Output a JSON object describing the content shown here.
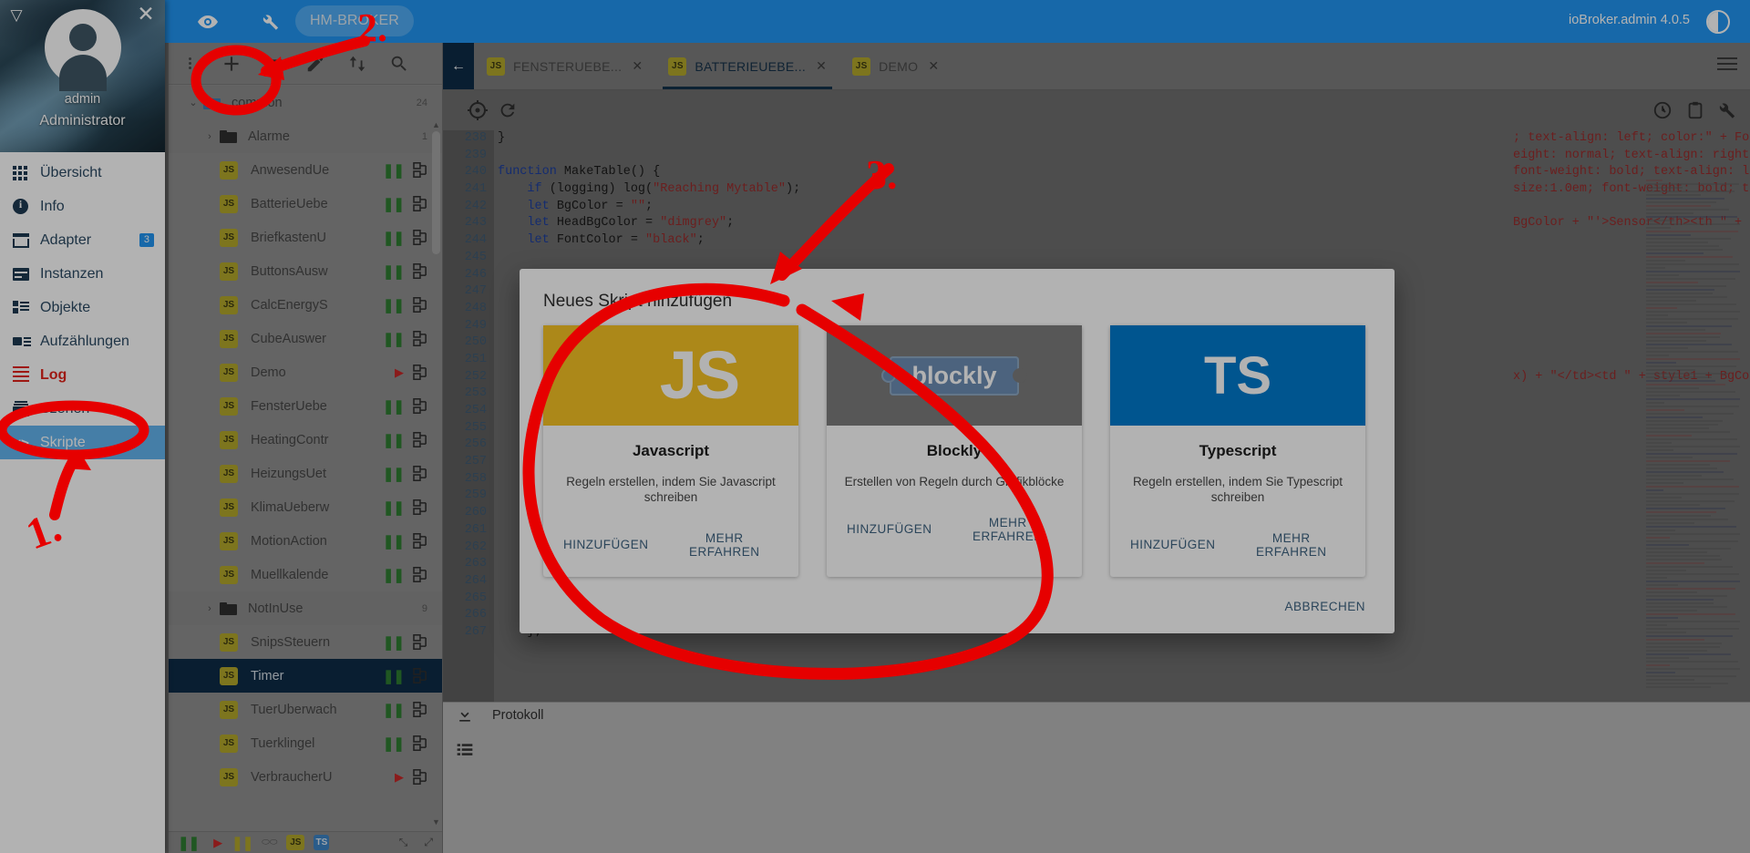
{
  "appbar": {
    "eye_icon": "eye-icon",
    "wrench_icon": "wrench-icon",
    "chip_label": "HM-BROKER",
    "title": "ioBroker.admin 4.0.5",
    "theme_icon": "theme-toggle-icon"
  },
  "drawer": {
    "user": "admin",
    "role": "Administrator",
    "collapse_icon": "collapse-drawer-icon",
    "close_icon": "close-icon",
    "items": [
      {
        "label": "Übersicht",
        "icon": "grid-icon",
        "badge": "",
        "state": "normal"
      },
      {
        "label": "Info",
        "icon": "info-icon",
        "badge": "",
        "state": "normal"
      },
      {
        "label": "Adapter",
        "icon": "shop-icon",
        "badge": "3",
        "state": "normal"
      },
      {
        "label": "Instanzen",
        "icon": "instances-icon",
        "badge": "",
        "state": "normal"
      },
      {
        "label": "Objekte",
        "icon": "objects-icon",
        "badge": "",
        "state": "normal"
      },
      {
        "label": "Aufzählungen",
        "icon": "enum-icon",
        "badge": "",
        "state": "normal"
      },
      {
        "label": "Log",
        "icon": "log-icon",
        "badge": "",
        "state": "alert"
      },
      {
        "label": "Szenen",
        "icon": "scenes-icon",
        "badge": "",
        "state": "normal"
      },
      {
        "label": "Skripte",
        "icon": "code-icon",
        "badge": "",
        "state": "active"
      }
    ]
  },
  "tree": {
    "toolbar": [
      {
        "name": "more-menu-icon",
        "glyph": "⋮"
      },
      {
        "name": "add-script-icon",
        "glyph": "+"
      },
      {
        "name": "new-folder-icon",
        "glyph": "▣"
      },
      {
        "name": "rename-edit-icon",
        "glyph": "✎"
      },
      {
        "name": "expand-collapse-icon",
        "glyph": "⇅"
      },
      {
        "name": "search-icon",
        "glyph": "⌕"
      }
    ],
    "rows": [
      {
        "type": "folder",
        "label": "common",
        "depth": 0,
        "count": "24",
        "expanded": true,
        "status": ""
      },
      {
        "type": "folder",
        "label": "Alarme",
        "depth": 1,
        "count": "1",
        "expanded": false,
        "status": ""
      },
      {
        "type": "script",
        "label": "AnwesendUe",
        "depth": 1,
        "count": "",
        "status": "paused"
      },
      {
        "type": "script",
        "label": "BatterieUebe",
        "depth": 1,
        "count": "",
        "status": "paused"
      },
      {
        "type": "script",
        "label": "BriefkastenU",
        "depth": 1,
        "count": "",
        "status": "paused"
      },
      {
        "type": "script",
        "label": "ButtonsAusw",
        "depth": 1,
        "count": "",
        "status": "paused"
      },
      {
        "type": "script",
        "label": "CalcEnergyS",
        "depth": 1,
        "count": "",
        "status": "paused"
      },
      {
        "type": "script",
        "label": "CubeAuswer",
        "depth": 1,
        "count": "",
        "status": "paused"
      },
      {
        "type": "script",
        "label": "Demo",
        "depth": 1,
        "count": "",
        "status": "running"
      },
      {
        "type": "script",
        "label": "FensterUebe",
        "depth": 1,
        "count": "",
        "status": "paused"
      },
      {
        "type": "script",
        "label": "HeatingContr",
        "depth": 1,
        "count": "",
        "status": "paused"
      },
      {
        "type": "script",
        "label": "HeizungsUet",
        "depth": 1,
        "count": "",
        "status": "paused"
      },
      {
        "type": "script",
        "label": "KlimaUeberw",
        "depth": 1,
        "count": "",
        "status": "paused"
      },
      {
        "type": "script",
        "label": "MotionAction",
        "depth": 1,
        "count": "",
        "status": "paused"
      },
      {
        "type": "script",
        "label": "Muellkalende",
        "depth": 1,
        "count": "",
        "status": "paused"
      },
      {
        "type": "folder",
        "label": "NotInUse",
        "depth": 1,
        "count": "9",
        "expanded": false,
        "status": ""
      },
      {
        "type": "script",
        "label": "SnipsSteuern",
        "depth": 1,
        "count": "",
        "status": "paused"
      },
      {
        "type": "script",
        "label": "Timer",
        "depth": 1,
        "count": "",
        "status": "paused",
        "selected": true
      },
      {
        "type": "script",
        "label": "TuerUberwach",
        "depth": 1,
        "count": "",
        "status": "paused"
      },
      {
        "type": "script",
        "label": "Tuerklingel",
        "depth": 1,
        "count": "",
        "status": "paused"
      },
      {
        "type": "script",
        "label": "VerbraucherU",
        "depth": 1,
        "count": "",
        "status": "running"
      }
    ],
    "statusbar": [
      {
        "name": "paused-filter-icon",
        "glyph": "❚❚"
      },
      {
        "name": "running-filter-icon",
        "glyph": "▶"
      },
      {
        "name": "inactive-filter-icon",
        "glyph": "❚❚"
      },
      {
        "name": "blockly-filter-icon",
        "glyph": "⬭"
      },
      {
        "name": "js-filter-icon",
        "glyph": "JS"
      },
      {
        "name": "ts-filter-icon",
        "glyph": "TS"
      }
    ]
  },
  "editor": {
    "back_icon": "back-arrow-icon",
    "tabs": [
      {
        "label": "FENSTERUEBE...",
        "icon": "js-file-icon",
        "active": false
      },
      {
        "label": "BATTERIEUEBE...",
        "icon": "js-file-icon",
        "active": true
      },
      {
        "label": "DEMO",
        "icon": "js-file-icon",
        "active": false
      }
    ],
    "tab_close_glyph": "✕",
    "menu_icon": "tabs-menu-icon",
    "toolbar": [
      {
        "name": "locate-icon",
        "glyph": "◎"
      },
      {
        "name": "restart-icon",
        "glyph": "⟳"
      },
      {
        "name": "history-icon",
        "glyph": "◷"
      },
      {
        "name": "clipboard-icon",
        "glyph": "▤"
      },
      {
        "name": "settings-icon",
        "glyph": "🔧"
      }
    ],
    "lines": [
      {
        "no": "238",
        "text": "}"
      },
      {
        "no": "239",
        "text": ""
      },
      {
        "no": "240",
        "text": "function MakeTable() {"
      },
      {
        "no": "241",
        "text": "    if (logging) log(\"Reaching Mytable\");"
      },
      {
        "no": "242",
        "text": "    let BgColor = \"\";"
      },
      {
        "no": "243",
        "text": "    let HeadBgColor = \"dimgrey\";"
      },
      {
        "no": "244",
        "text": "    let FontColor = \"black\";"
      },
      {
        "no": "245",
        "text": ""
      },
      {
        "no": "246",
        "text": ""
      },
      {
        "no": "247",
        "text": ""
      },
      {
        "no": "248",
        "text": ""
      },
      {
        "no": "249",
        "text": ""
      },
      {
        "no": "250",
        "text": ""
      },
      {
        "no": "251",
        "text": ""
      },
      {
        "no": "252",
        "text": ""
      },
      {
        "no": "253",
        "text": ""
      },
      {
        "no": "254",
        "text": ""
      },
      {
        "no": "255",
        "text": ""
      },
      {
        "no": "256",
        "text": ""
      },
      {
        "no": "257",
        "text": ""
      },
      {
        "no": "258",
        "text": ""
      },
      {
        "no": "259",
        "text": ""
      },
      {
        "no": "260",
        "text": ""
      },
      {
        "no": "261",
        "text": ""
      },
      {
        "no": "262",
        "text": ""
      },
      {
        "no": "263",
        "text": ""
      },
      {
        "no": "264",
        "text": ""
      },
      {
        "no": "265",
        "text": ""
      },
      {
        "no": "266",
        "text": ""
      },
      {
        "no": "267",
        "text": "    };"
      }
    ],
    "right_fragments": [
      "; text-align: left; color:\" + Fo",
      "eight: normal; text-align: right",
      "font-weight: bold; text-align: le",
      "size:1.0em; font-weight: bold; t",
      "",
      "BgColor + \"'>Sensor</th><th \" +",
      "",
      "",
      "",
      "",
      "",
      "",
      "",
      "",
      "x) + \"</td><td \" + style1 + BgCo"
    ]
  },
  "protokoll": {
    "title": "Protokoll",
    "download_icon": "download-icon",
    "list_icon": "list-view-icon"
  },
  "dialog": {
    "title": "Neues Skript hinzufügen",
    "cancel_label": "ABBRECHEN",
    "cards": [
      {
        "id": "javascript",
        "logo": "js-logo",
        "logo_text": "JS",
        "title": "Javascript",
        "desc": "Regeln erstellen, indem Sie Javascript schreiben",
        "add_label": "HINZUFÜGEN",
        "more_label": "MEHR ERFAHREN",
        "bg": "#f7c325"
      },
      {
        "id": "blockly",
        "logo": "blockly-logo",
        "logo_text": "blockly",
        "title": "Blockly",
        "desc": "Erstellen von Regeln durch Grafikblöcke",
        "add_label": "HINZUFÜGEN",
        "more_label": "MEHR ERFAHREN",
        "bg": "#7d7d7d"
      },
      {
        "id": "typescript",
        "logo": "ts-logo",
        "logo_text": "TS",
        "title": "Typescript",
        "desc": "Regeln erstellen, indem Sie Typescript schreiben",
        "add_label": "HINZUFÜGEN",
        "more_label": "MEHR ERFAHREN",
        "bg": "#017acd"
      }
    ]
  },
  "annotations": {
    "color": "#e60000",
    "marks": [
      {
        "id": "1",
        "label": "1.",
        "target": "sidebar-item-skripte"
      },
      {
        "id": "2",
        "label": "2.",
        "target": "add-script-icon"
      },
      {
        "id": "3",
        "label": "3.",
        "target": "new-script-dialog"
      }
    ]
  }
}
